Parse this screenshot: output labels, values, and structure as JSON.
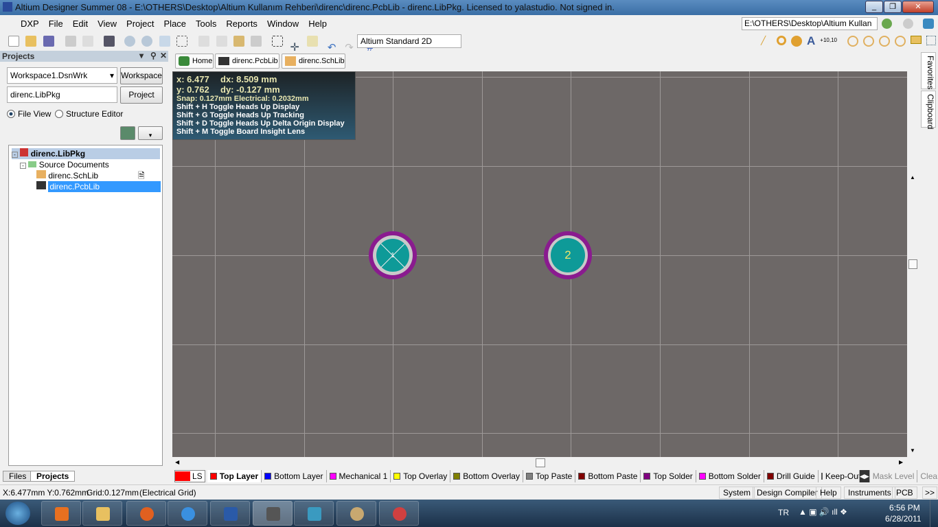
{
  "title": "Altium Designer Summer 08 - E:\\OTHERS\\Desktop\\Altium Kullanım Rehberi\\direnc\\direnc.PcbLib - direnc.LibPkg. Licensed to yalastudio. Not signed in.",
  "menu": [
    "DXP",
    "File",
    "Edit",
    "View",
    "Project",
    "Place",
    "Tools",
    "Reports",
    "Window",
    "Help"
  ],
  "toolbar": {
    "view_combo": "Altium Standard 2D",
    "path_combo": "E:\\OTHERS\\Desktop\\Altium Kullan"
  },
  "projects": {
    "title": "Projects",
    "workspace_combo": "Workspace1.DsnWrk",
    "workspace_btn": "Workspace",
    "project_field": "direnc.LibPkg",
    "project_btn": "Project",
    "file_view": "File View",
    "structure_editor": "Structure Editor",
    "tree": {
      "root": "direnc.LibPkg",
      "folder": "Source Documents",
      "items": [
        "direnc.SchLib",
        "direnc.PcbLib"
      ],
      "selected": "direnc.PcbLib"
    },
    "bottom_tabs": [
      "Files",
      "Projects"
    ]
  },
  "doc_tabs": [
    "Home",
    "direnc.PcbLib",
    "direnc.SchLib"
  ],
  "hud": {
    "x": "x:  6.477",
    "dx": "dx:  8.509  mm",
    "y": "y:  0.762",
    "dy": "dy: -0.127  mm",
    "snap": "Snap: 0.127mm Electrical: 0.2032mm",
    "shortcuts": [
      "Shift + H  Toggle Heads Up Display",
      "Shift + G  Toggle Heads Up Tracking",
      "Shift + D  Toggle Heads Up Delta Origin Display",
      "Shift + M  Toggle Board Insight Lens"
    ]
  },
  "pads": [
    {
      "label": "1"
    },
    {
      "label": "2"
    }
  ],
  "right_tabs": [
    "Favorites",
    "Clipboard"
  ],
  "layers": {
    "ls": "LS",
    "items": [
      {
        "name": "Top Layer",
        "color": "#ff0000"
      },
      {
        "name": "Bottom Layer",
        "color": "#0000ff"
      },
      {
        "name": "Mechanical 1",
        "color": "#ff00ff"
      },
      {
        "name": "Top Overlay",
        "color": "#ffff00"
      },
      {
        "name": "Bottom Overlay",
        "color": "#808000"
      },
      {
        "name": "Top Paste",
        "color": "#808080"
      },
      {
        "name": "Bottom Paste",
        "color": "#800000"
      },
      {
        "name": "Top Solder",
        "color": "#800080"
      },
      {
        "name": "Bottom Solder",
        "color": "#ff00ff"
      },
      {
        "name": "Drill Guide",
        "color": "#800000"
      },
      {
        "name": "Keep-Out",
        "color": "#ff00ff"
      }
    ],
    "mask_level": "Mask Level",
    "clear": "Clear"
  },
  "status": {
    "coords": "X:6.477mm Y:0.762mm",
    "grid": "Grid:0.127mm",
    "grid_type": "(Electrical Grid)",
    "buttons": [
      "System",
      "Design Compiler",
      "Help",
      "Instruments",
      "PCB",
      ">>"
    ]
  },
  "taskbar": {
    "lang": "TR",
    "time": "6:56 PM",
    "date": "6/28/2011"
  }
}
